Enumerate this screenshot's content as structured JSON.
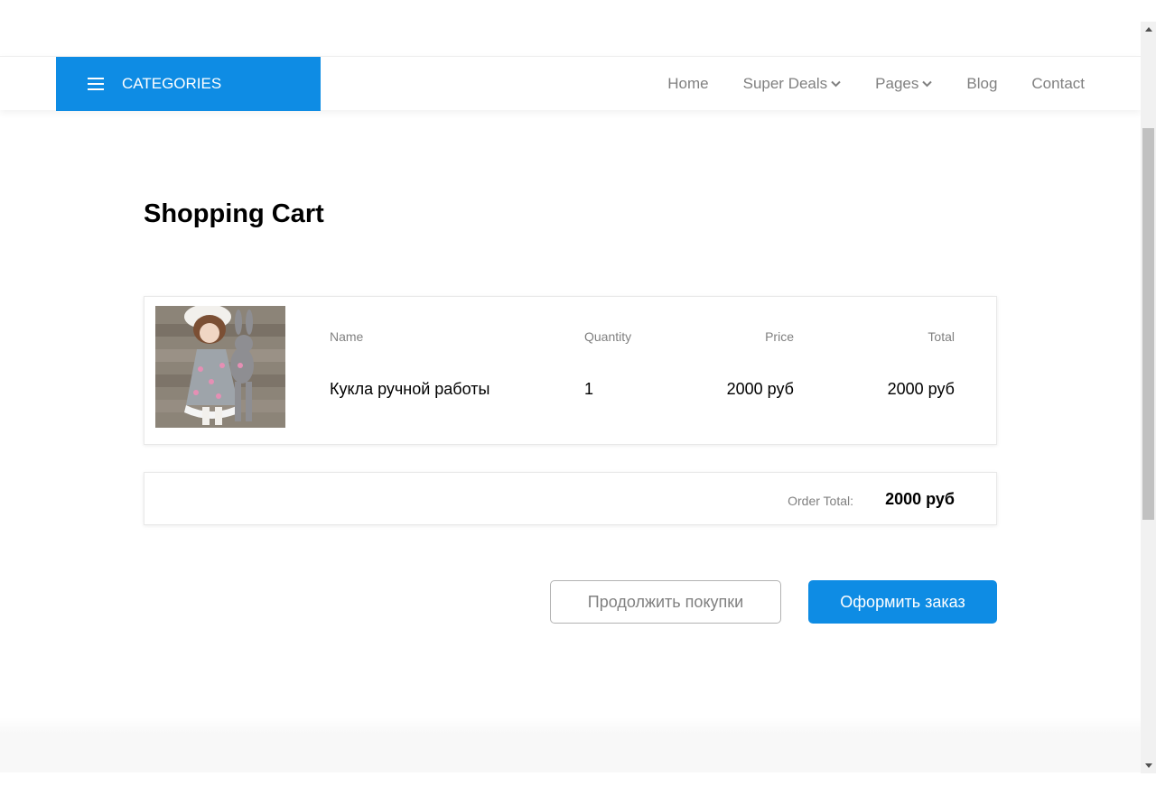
{
  "navbar": {
    "categories_label": "CATEGORIES",
    "links": [
      {
        "label": "Home"
      },
      {
        "label": "Super Deals"
      },
      {
        "label": "Pages"
      },
      {
        "label": "Blog"
      },
      {
        "label": "Contact"
      }
    ]
  },
  "page": {
    "title": "Shopping Cart"
  },
  "cart": {
    "headers": {
      "name": "Name",
      "quantity": "Quantity",
      "price": "Price",
      "total": "Total"
    },
    "items": [
      {
        "name": "Кукла ручной работы",
        "quantity": "1",
        "price": "2000 руб",
        "total": "2000 руб"
      }
    ],
    "order_total_label": "Order Total:",
    "order_total_value": "2000 руб"
  },
  "actions": {
    "continue_label": "Продолжить покупки",
    "checkout_label": "Оформить заказ"
  },
  "colors": {
    "accent": "#0e8ce4",
    "muted_text": "#808080"
  }
}
